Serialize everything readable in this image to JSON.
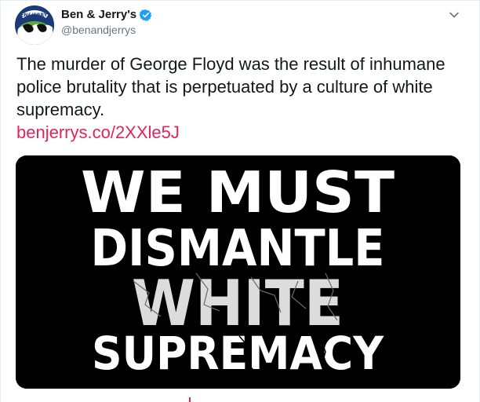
{
  "author": {
    "display_name": "Ben & Jerry's",
    "handle": "@benandjerrys",
    "verified": true,
    "avatar_text": "BEN&JERRY'S"
  },
  "tweet": {
    "text": "The murder of George Floyd was the result of inhumane police brutality that is perpetuated by a culture of white supremacy.",
    "link_text": "benjerrys.co/2XXle5J"
  },
  "media": {
    "lines": [
      "WE MUST",
      "DISMANTLE",
      "WHITE",
      "SUPREMACY"
    ]
  },
  "colors": {
    "link": "#e0245e",
    "verified": "#1da1f2",
    "media_background": "#000000",
    "media_text": "#ffffff"
  },
  "icons": {
    "verified": "verified-badge-icon",
    "more": "chevron-down-icon"
  }
}
